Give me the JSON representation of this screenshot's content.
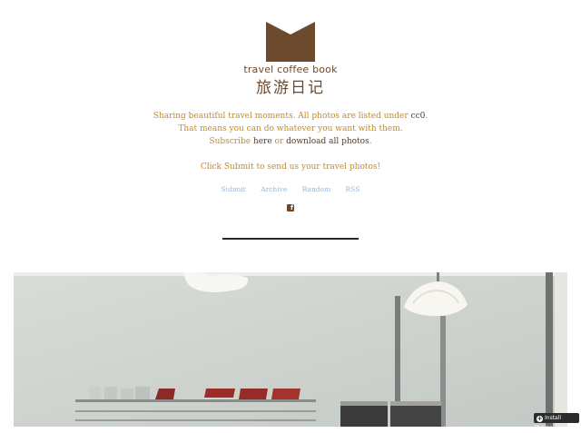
{
  "header": {
    "brand_name": "travel coffee book",
    "brand_cn": "旅游日记",
    "logo_icon": "book-icon",
    "colors": {
      "brand": "#6b4a2e",
      "accent": "#c78a1c",
      "nav": "#9ab7d6"
    }
  },
  "description": {
    "line1_text": "Sharing beautiful travel moments. All photos are listed under ",
    "line1_link": "cc0",
    "line1_end": ".",
    "line2_text": "That means you can do whatever you want with them.",
    "line3_text1": "Subscribe ",
    "line3_link1": "here",
    "line3_text2": " or ",
    "line3_link2": "download all photos",
    "line3_end": "."
  },
  "submit_note": "Click Submit to send us your travel photos!",
  "nav": {
    "items": [
      "Submit",
      "Archive",
      "Random",
      "RSS"
    ]
  },
  "social": {
    "icon": "facebook-icon",
    "glyph": "f"
  },
  "install_button": {
    "label": "Install Theme",
    "icon": "plus-icon"
  }
}
